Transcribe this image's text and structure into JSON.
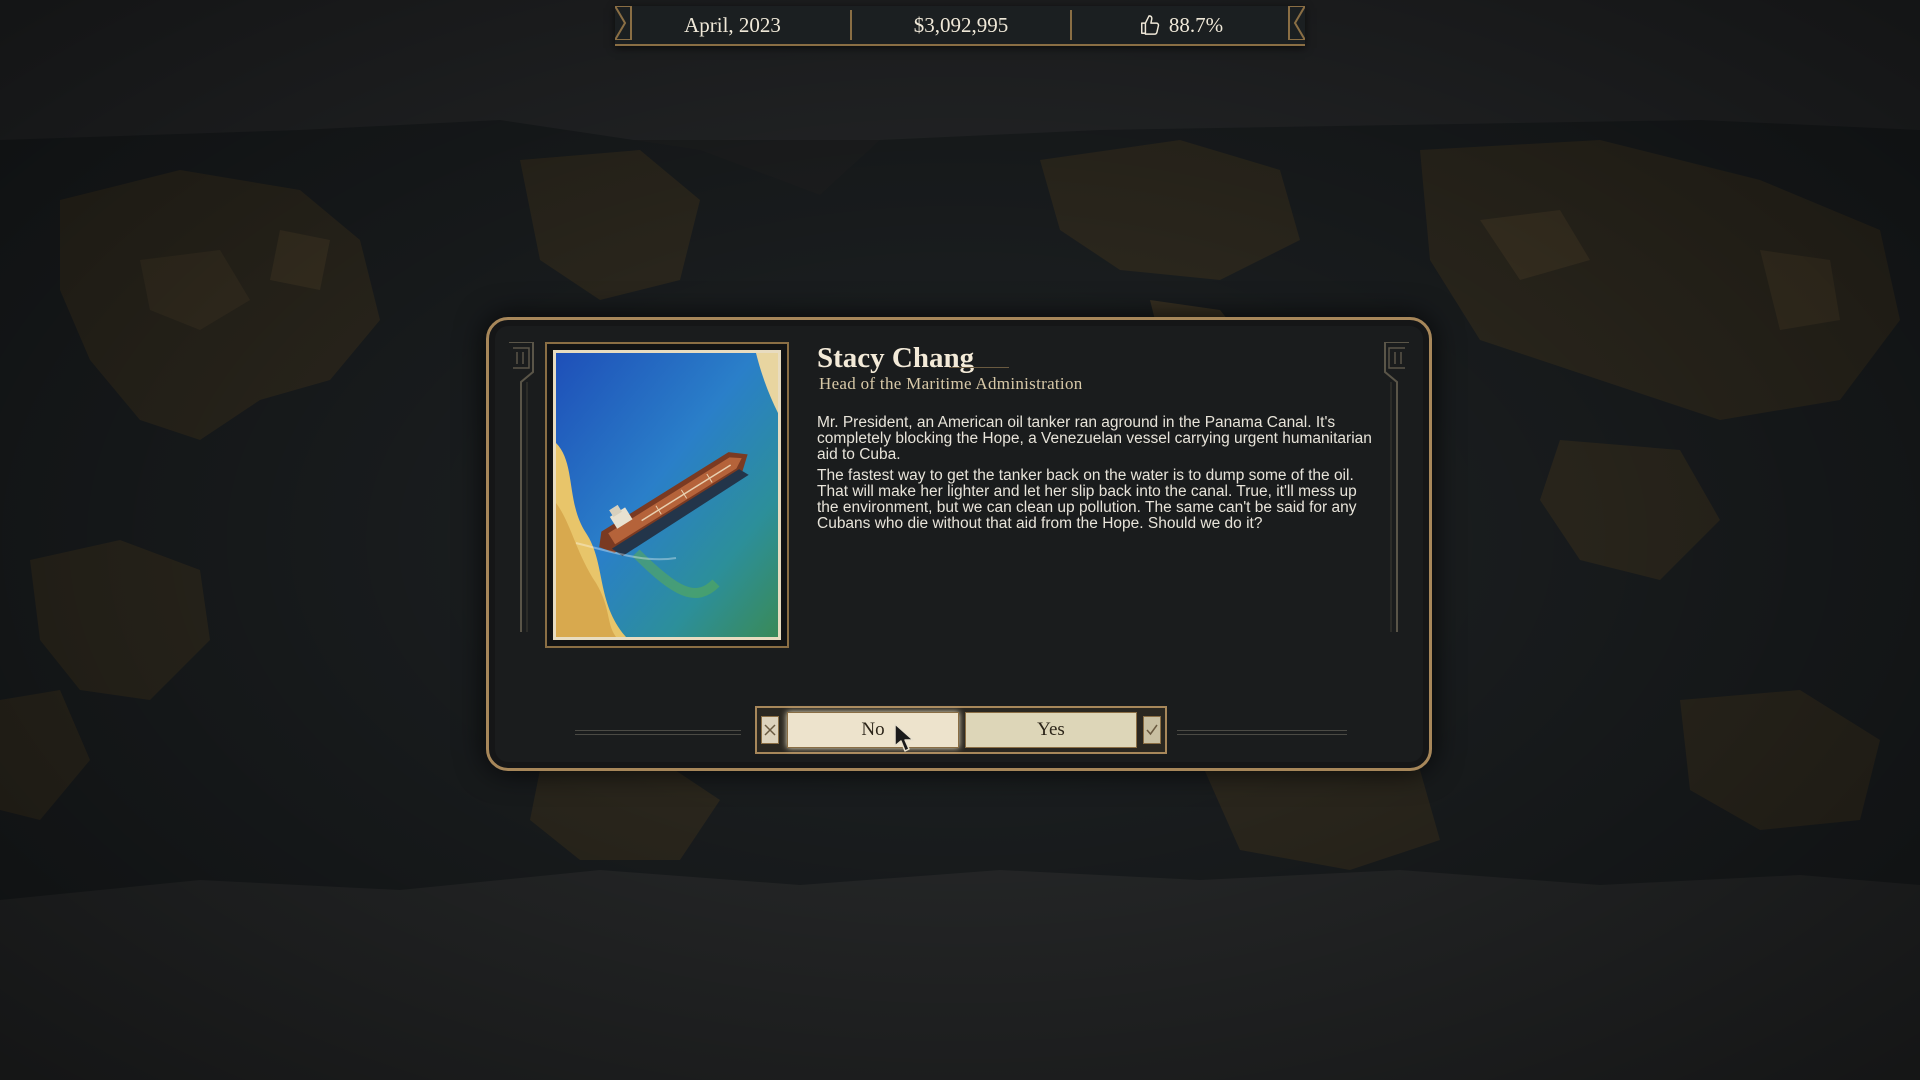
{
  "topbar": {
    "date": "April, 2023",
    "money": "$3,092,995",
    "approval": "88.7%",
    "approval_icon": "thumbs-up-icon"
  },
  "dialog": {
    "speaker_name": "Stacy Chang",
    "speaker_role": "Head of the Maritime Administration",
    "paragraphs": [
      "Mr. President, an American oil tanker ran aground in the Panama Canal. It's completely blocking the Hope, a Venezuelan vessel carrying urgent humanitarian aid to Cuba.",
      "The fastest way to get the tanker back on the water is to dump some of the oil. That will make her lighter and let her slip back into the canal. True, it'll mess up the environment, but we can clean up pollution. The same can't be said for any Cubans who die without that aid from the Hope. Should we do it?"
    ],
    "portrait_icon": "oil-tanker-painting",
    "buttons": {
      "no_label": "No",
      "yes_label": "Yes",
      "no_icon": "close-icon",
      "yes_icon": "check-icon"
    }
  },
  "colors": {
    "accent_gold": "#a7875a",
    "panel_bg": "#1a1c1d",
    "button_bg": "#ede3cc"
  }
}
